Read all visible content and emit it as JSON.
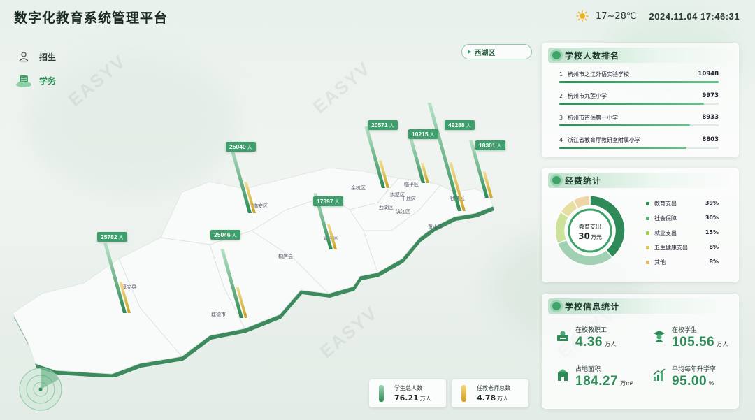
{
  "header": {
    "title": "数字化教育系统管理平台",
    "temperature": "17~28℃",
    "datetime": "2024.11.04 17:46:31"
  },
  "nav": {
    "items": [
      {
        "label": "招生",
        "icon": "person-icon",
        "active": false
      },
      {
        "label": "学务",
        "icon": "stack-icon",
        "active": true
      }
    ]
  },
  "district_selector": {
    "value": "西湖区"
  },
  "map": {
    "district_labels": [
      "余杭区",
      "临平区",
      "拱墅区",
      "上城区",
      "西湖区",
      "滨江区",
      "萧山区",
      "钱塘区",
      "临安区",
      "富阳区",
      "桐庐县",
      "淳安县",
      "建德市"
    ],
    "markers": [
      {
        "value": "25782",
        "unit": "人",
        "students": 25782
      },
      {
        "value": "25040",
        "unit": "人",
        "students": 25040
      },
      {
        "value": "25046",
        "unit": "人",
        "students": 25046
      },
      {
        "value": "17397",
        "unit": "人",
        "students": 17397
      },
      {
        "value": "20571",
        "unit": "人",
        "students": 20571
      },
      {
        "value": "10215",
        "unit": "人",
        "students": 10215
      },
      {
        "value": "49288",
        "unit": "人",
        "students": 49288
      },
      {
        "value": "18301",
        "unit": "人",
        "students": 18301
      }
    ]
  },
  "summary": {
    "students": {
      "label": "学生总人数",
      "value": "76.21",
      "unit": "万人"
    },
    "teachers": {
      "label": "任教老师总数",
      "value": "4.78",
      "unit": "万人"
    }
  },
  "ranking": {
    "title": "学校人数排名",
    "rows": [
      {
        "no": "1",
        "name": "杭州市之江外语实验学校",
        "value": "10948",
        "ratio": 1.0
      },
      {
        "no": "2",
        "name": "杭州市九莲小学",
        "value": "9973",
        "ratio": 0.91
      },
      {
        "no": "3",
        "name": "杭州市古荡第一小学",
        "value": "8933",
        "ratio": 0.82
      },
      {
        "no": "4",
        "name": "浙江省教育厅教研室附属小学",
        "value": "8803",
        "ratio": 0.8
      }
    ]
  },
  "funding": {
    "title": "经费统计",
    "center_label": "教育支出",
    "center_value": "30",
    "center_unit": "万元",
    "items": [
      {
        "label": "教育支出",
        "pct": "39%",
        "share": 39,
        "color": "#2e8b57"
      },
      {
        "label": "社会保障",
        "pct": "30%",
        "share": 30,
        "color": "#5bb07d"
      },
      {
        "label": "就业支出",
        "pct": "15%",
        "share": 15,
        "color": "#a9cf4f"
      },
      {
        "label": "卫生健康支出",
        "pct": "8%",
        "share": 8,
        "color": "#d8c75a"
      },
      {
        "label": "其他",
        "pct": "8%",
        "share": 8,
        "color": "#e6b763"
      }
    ]
  },
  "school_info": {
    "title": "学校信息统计",
    "items": [
      {
        "label": "在校教职工",
        "value": "4.36",
        "unit": "万人",
        "icon": "teacher-icon"
      },
      {
        "label": "在校学生",
        "value": "105.56",
        "unit": "万人",
        "icon": "student-icon"
      },
      {
        "label": "占地面积",
        "value": "184.27",
        "unit": "万m²",
        "icon": "building-icon"
      },
      {
        "label": "平均每年升学率",
        "value": "95.00",
        "unit": "%",
        "icon": "chart-up-icon"
      }
    ]
  },
  "colors": {
    "accent": "#2e8b57",
    "marker": "#3e9e6c",
    "gold": "#d4b13a"
  }
}
